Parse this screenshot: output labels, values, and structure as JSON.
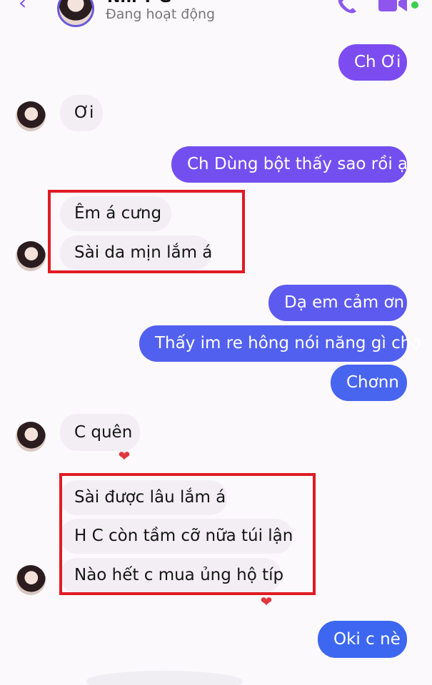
{
  "header": {
    "contact_name": "Nhi T G",
    "status": "Đang hoạt động"
  },
  "messages": [
    {
      "id": "m1",
      "side": "sent",
      "text": "Ch Ơi"
    },
    {
      "id": "m2",
      "side": "received",
      "text": "Ơi"
    },
    {
      "id": "m3",
      "side": "sent",
      "text": "Ch Dùng bột thấy sao rồi ạ"
    },
    {
      "id": "m4",
      "side": "received",
      "text": "Êm á cưng"
    },
    {
      "id": "m5",
      "side": "received",
      "text": "Sài da mịn lắm á"
    },
    {
      "id": "m6",
      "side": "sent",
      "text": "Dạ em cảm ơn"
    },
    {
      "id": "m7",
      "side": "sent",
      "text": "Thấy im re hông nói năng gì chợ"
    },
    {
      "id": "m8",
      "side": "sent",
      "text": "Chơnn"
    },
    {
      "id": "m9",
      "side": "received",
      "text": "C quên"
    },
    {
      "id": "m10",
      "side": "received",
      "text": "Sài được lâu lắm á"
    },
    {
      "id": "m11",
      "side": "received",
      "text": "H C còn tầm cỡ nữa túi lận"
    },
    {
      "id": "m12",
      "side": "received",
      "text": "Nào hết c mua ủng hộ típ"
    },
    {
      "id": "m13",
      "side": "sent",
      "text": "Oki c nè"
    }
  ],
  "reactions": {
    "heart_glyph": "❤"
  },
  "colors": {
    "sent_purple": "#7a4df0",
    "sent_blue": "#3d67f0",
    "highlight_red": "#e01b24",
    "received_bg": "#f2eef3"
  }
}
